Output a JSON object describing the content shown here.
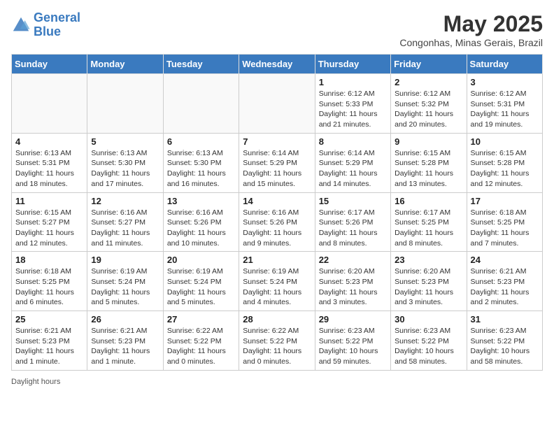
{
  "header": {
    "logo_line1": "General",
    "logo_line2": "Blue",
    "month": "May 2025",
    "location": "Congonhas, Minas Gerais, Brazil"
  },
  "weekdays": [
    "Sunday",
    "Monday",
    "Tuesday",
    "Wednesday",
    "Thursday",
    "Friday",
    "Saturday"
  ],
  "weeks": [
    [
      {
        "day": "",
        "info": ""
      },
      {
        "day": "",
        "info": ""
      },
      {
        "day": "",
        "info": ""
      },
      {
        "day": "",
        "info": ""
      },
      {
        "day": "1",
        "info": "Sunrise: 6:12 AM\nSunset: 5:33 PM\nDaylight: 11 hours and 21 minutes."
      },
      {
        "day": "2",
        "info": "Sunrise: 6:12 AM\nSunset: 5:32 PM\nDaylight: 11 hours and 20 minutes."
      },
      {
        "day": "3",
        "info": "Sunrise: 6:12 AM\nSunset: 5:31 PM\nDaylight: 11 hours and 19 minutes."
      }
    ],
    [
      {
        "day": "4",
        "info": "Sunrise: 6:13 AM\nSunset: 5:31 PM\nDaylight: 11 hours and 18 minutes."
      },
      {
        "day": "5",
        "info": "Sunrise: 6:13 AM\nSunset: 5:30 PM\nDaylight: 11 hours and 17 minutes."
      },
      {
        "day": "6",
        "info": "Sunrise: 6:13 AM\nSunset: 5:30 PM\nDaylight: 11 hours and 16 minutes."
      },
      {
        "day": "7",
        "info": "Sunrise: 6:14 AM\nSunset: 5:29 PM\nDaylight: 11 hours and 15 minutes."
      },
      {
        "day": "8",
        "info": "Sunrise: 6:14 AM\nSunset: 5:29 PM\nDaylight: 11 hours and 14 minutes."
      },
      {
        "day": "9",
        "info": "Sunrise: 6:15 AM\nSunset: 5:28 PM\nDaylight: 11 hours and 13 minutes."
      },
      {
        "day": "10",
        "info": "Sunrise: 6:15 AM\nSunset: 5:28 PM\nDaylight: 11 hours and 12 minutes."
      }
    ],
    [
      {
        "day": "11",
        "info": "Sunrise: 6:15 AM\nSunset: 5:27 PM\nDaylight: 11 hours and 12 minutes."
      },
      {
        "day": "12",
        "info": "Sunrise: 6:16 AM\nSunset: 5:27 PM\nDaylight: 11 hours and 11 minutes."
      },
      {
        "day": "13",
        "info": "Sunrise: 6:16 AM\nSunset: 5:26 PM\nDaylight: 11 hours and 10 minutes."
      },
      {
        "day": "14",
        "info": "Sunrise: 6:16 AM\nSunset: 5:26 PM\nDaylight: 11 hours and 9 minutes."
      },
      {
        "day": "15",
        "info": "Sunrise: 6:17 AM\nSunset: 5:26 PM\nDaylight: 11 hours and 8 minutes."
      },
      {
        "day": "16",
        "info": "Sunrise: 6:17 AM\nSunset: 5:25 PM\nDaylight: 11 hours and 8 minutes."
      },
      {
        "day": "17",
        "info": "Sunrise: 6:18 AM\nSunset: 5:25 PM\nDaylight: 11 hours and 7 minutes."
      }
    ],
    [
      {
        "day": "18",
        "info": "Sunrise: 6:18 AM\nSunset: 5:25 PM\nDaylight: 11 hours and 6 minutes."
      },
      {
        "day": "19",
        "info": "Sunrise: 6:19 AM\nSunset: 5:24 PM\nDaylight: 11 hours and 5 minutes."
      },
      {
        "day": "20",
        "info": "Sunrise: 6:19 AM\nSunset: 5:24 PM\nDaylight: 11 hours and 5 minutes."
      },
      {
        "day": "21",
        "info": "Sunrise: 6:19 AM\nSunset: 5:24 PM\nDaylight: 11 hours and 4 minutes."
      },
      {
        "day": "22",
        "info": "Sunrise: 6:20 AM\nSunset: 5:23 PM\nDaylight: 11 hours and 3 minutes."
      },
      {
        "day": "23",
        "info": "Sunrise: 6:20 AM\nSunset: 5:23 PM\nDaylight: 11 hours and 3 minutes."
      },
      {
        "day": "24",
        "info": "Sunrise: 6:21 AM\nSunset: 5:23 PM\nDaylight: 11 hours and 2 minutes."
      }
    ],
    [
      {
        "day": "25",
        "info": "Sunrise: 6:21 AM\nSunset: 5:23 PM\nDaylight: 11 hours and 1 minute."
      },
      {
        "day": "26",
        "info": "Sunrise: 6:21 AM\nSunset: 5:23 PM\nDaylight: 11 hours and 1 minute."
      },
      {
        "day": "27",
        "info": "Sunrise: 6:22 AM\nSunset: 5:22 PM\nDaylight: 11 hours and 0 minutes."
      },
      {
        "day": "28",
        "info": "Sunrise: 6:22 AM\nSunset: 5:22 PM\nDaylight: 11 hours and 0 minutes."
      },
      {
        "day": "29",
        "info": "Sunrise: 6:23 AM\nSunset: 5:22 PM\nDaylight: 10 hours and 59 minutes."
      },
      {
        "day": "30",
        "info": "Sunrise: 6:23 AM\nSunset: 5:22 PM\nDaylight: 10 hours and 58 minutes."
      },
      {
        "day": "31",
        "info": "Sunrise: 6:23 AM\nSunset: 5:22 PM\nDaylight: 10 hours and 58 minutes."
      }
    ]
  ],
  "footer": {
    "label": "Daylight hours"
  }
}
